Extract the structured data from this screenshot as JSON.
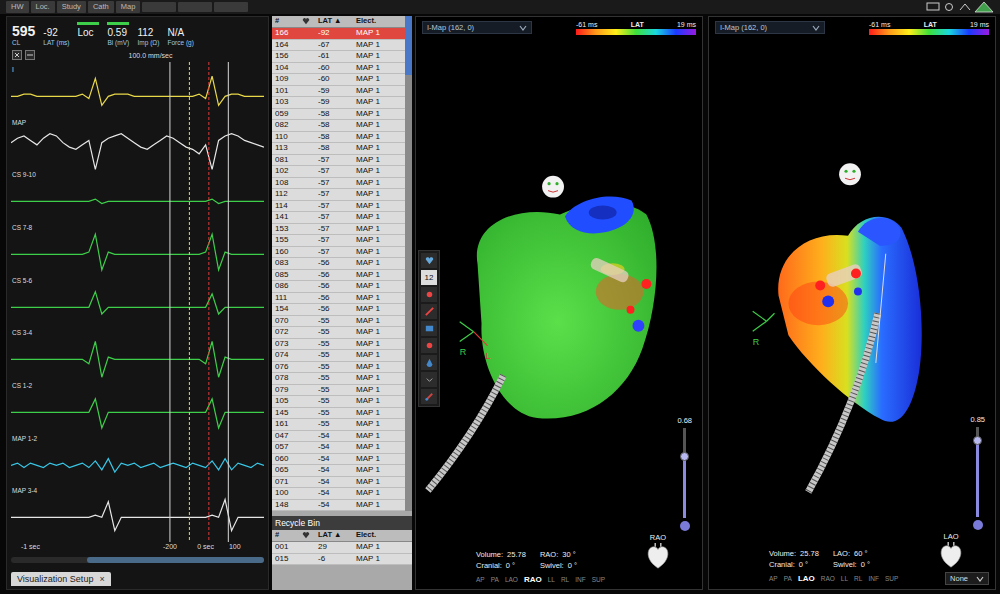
{
  "topbar": {
    "tabs": [
      {
        "label": "HW"
      },
      {
        "label": "Loc."
      },
      {
        "label": "Study"
      },
      {
        "label": "Cath"
      },
      {
        "label": "Map"
      }
    ]
  },
  "readouts": [
    {
      "value": "595",
      "label": "CL",
      "indicator": false,
      "large": true
    },
    {
      "value": "-92",
      "label": "LAT (ms)",
      "indicator": false,
      "large": false
    },
    {
      "value": "Loc",
      "label": "",
      "indicator": true,
      "large": false
    },
    {
      "value": "0.59",
      "label": "Bi (mV)",
      "indicator": true,
      "large": false
    },
    {
      "value": "112",
      "label": "Imp (Ω)",
      "indicator": false,
      "large": false
    },
    {
      "value": "N/A",
      "label": "Force (g)",
      "indicator": false,
      "large": false
    }
  ],
  "signals": {
    "speed": "100.0 mm/sec",
    "traces": [
      {
        "label": "I",
        "color": "#e8d84a",
        "values": [
          0,
          0,
          1,
          1,
          0,
          0,
          0,
          0,
          0,
          0,
          0,
          1,
          -1,
          8,
          -4,
          0,
          1,
          1,
          1,
          0,
          0,
          0,
          0,
          0,
          0,
          0,
          0,
          0,
          0,
          1,
          -1,
          9,
          -4,
          0,
          1,
          1,
          0,
          0,
          0,
          0
        ]
      },
      {
        "label": "MAP",
        "color": "#e6e6e6",
        "values": [
          3,
          5,
          6,
          4,
          2,
          5,
          7,
          6,
          3,
          1,
          0,
          2,
          4,
          -9,
          3,
          5,
          6,
          7,
          5,
          3,
          1,
          0,
          2,
          4,
          6,
          5,
          3,
          1,
          0,
          -2,
          2,
          -9,
          4,
          6,
          7,
          6,
          4,
          3,
          2,
          1
        ]
      },
      {
        "label": "CS 9-10",
        "color": "#3ecf4a",
        "values": [
          0,
          0,
          0,
          0,
          0,
          0,
          0,
          0,
          0,
          0,
          0,
          0,
          0,
          1,
          -1,
          0,
          0,
          0,
          0,
          0,
          0,
          0,
          0,
          0,
          0,
          0,
          0,
          0,
          0,
          0,
          0,
          1,
          -1,
          0,
          0,
          0,
          0,
          0,
          0,
          0
        ]
      },
      {
        "label": "CS 7-8",
        "color": "#3ecf4a",
        "values": [
          0,
          0,
          0,
          0,
          0,
          0,
          0,
          0,
          0,
          0,
          0,
          0,
          1,
          9,
          -7,
          1,
          0,
          0,
          0,
          0,
          0,
          0,
          0,
          0,
          0,
          0,
          0,
          0,
          0,
          0,
          1,
          9,
          -7,
          1,
          0,
          0,
          0,
          0,
          0,
          0
        ]
      },
      {
        "label": "CS 5-6",
        "color": "#3ecf4a",
        "values": [
          0,
          0,
          0,
          0,
          0,
          0,
          0,
          0,
          0,
          0,
          0,
          0,
          0,
          7,
          -3,
          0,
          0,
          0,
          0,
          0,
          0,
          0,
          0,
          0,
          0,
          0,
          0,
          0,
          0,
          0,
          0,
          6,
          -3,
          0,
          0,
          0,
          0,
          0,
          0,
          0
        ]
      },
      {
        "label": "CS 3-4",
        "color": "#3ecf4a",
        "values": [
          0,
          0,
          0,
          0,
          0,
          0,
          0,
          0,
          0,
          0,
          0,
          0,
          -2,
          8,
          -8,
          1,
          0,
          0,
          0,
          0,
          0,
          0,
          0,
          0,
          0,
          0,
          0,
          0,
          0,
          0,
          -2,
          8,
          -8,
          1,
          0,
          0,
          0,
          0,
          0,
          0
        ]
      },
      {
        "label": "CS 1-2",
        "color": "#3ecf4a",
        "values": [
          0,
          0,
          0,
          0,
          0,
          0,
          0,
          0,
          0,
          0,
          0,
          0,
          0,
          6,
          -7,
          0,
          0,
          0,
          0,
          0,
          0,
          0,
          0,
          0,
          0,
          0,
          0,
          0,
          0,
          0,
          0,
          6,
          -7,
          0,
          0,
          0,
          0,
          0,
          0,
          0
        ]
      },
      {
        "label": "MAP 1-2",
        "color": "#39c6e6",
        "values": [
          0,
          1,
          -1,
          1,
          0,
          -1,
          1,
          0,
          1,
          -1,
          0,
          1,
          -1,
          2,
          -2,
          3,
          -3,
          1,
          0,
          1,
          -1,
          0,
          1,
          -1,
          0,
          1,
          0,
          -1,
          1,
          0,
          -1,
          2,
          -2,
          3,
          -2,
          1,
          0,
          -1,
          1,
          0
        ]
      },
      {
        "label": "MAP 3-4",
        "color": "#e6e6e6",
        "values": [
          0,
          0,
          0,
          0,
          0,
          0,
          0,
          0,
          0,
          0,
          0,
          0,
          0,
          1,
          0,
          7,
          -6,
          0,
          0,
          0,
          0,
          0,
          0,
          0,
          0,
          0,
          0,
          0,
          0,
          0,
          0,
          1,
          0,
          8,
          -6,
          0,
          0,
          0,
          0,
          0
        ]
      }
    ],
    "markers": [
      {
        "t": 24.5,
        "color": "#d8d8d8",
        "dashed": false
      },
      {
        "t": 27.5,
        "color": "#e8d84a",
        "dashed": true
      },
      {
        "t": 30.5,
        "color": "#e03a3a",
        "dashed": true
      },
      {
        "t": 33.5,
        "color": "#d8d8d8",
        "dashed": false
      }
    ],
    "axis": [
      {
        "label": "-1 sec",
        "t": 3
      },
      {
        "label": "-200",
        "t": 24.5
      },
      {
        "label": "0 sec",
        "t": 30
      },
      {
        "label": "100",
        "t": 34.5
      }
    ]
  },
  "bottom_tab": {
    "label": "Visualization Setup",
    "close": "×"
  },
  "point_list": {
    "columns": [
      {
        "label": "#",
        "kind": "text"
      },
      {
        "label": "",
        "kind": "icon"
      },
      {
        "label": "LAT ▲",
        "kind": "text"
      },
      {
        "label": "Elect.",
        "kind": "text"
      }
    ],
    "rows": [
      {
        "id": "166",
        "lat": "-92",
        "electrode": "MAP 1",
        "selected": true
      },
      {
        "id": "164",
        "lat": "-67",
        "electrode": "MAP 1",
        "selected": false
      },
      {
        "id": "156",
        "lat": "-61",
        "electrode": "MAP 1",
        "selected": false
      },
      {
        "id": "104",
        "lat": "-60",
        "electrode": "MAP 1",
        "selected": false
      },
      {
        "id": "109",
        "lat": "-60",
        "electrode": "MAP 1",
        "selected": false
      },
      {
        "id": "101",
        "lat": "-59",
        "electrode": "MAP 1",
        "selected": false
      },
      {
        "id": "103",
        "lat": "-59",
        "electrode": "MAP 1",
        "selected": false
      },
      {
        "id": "059",
        "lat": "-58",
        "electrode": "MAP 1",
        "selected": false
      },
      {
        "id": "082",
        "lat": "-58",
        "electrode": "MAP 1",
        "selected": false
      },
      {
        "id": "110",
        "lat": "-58",
        "electrode": "MAP 1",
        "selected": false
      },
      {
        "id": "113",
        "lat": "-58",
        "electrode": "MAP 1",
        "selected": false
      },
      {
        "id": "081",
        "lat": "-57",
        "electrode": "MAP 1",
        "selected": false
      },
      {
        "id": "102",
        "lat": "-57",
        "electrode": "MAP 1",
        "selected": false
      },
      {
        "id": "108",
        "lat": "-57",
        "electrode": "MAP 1",
        "selected": false
      },
      {
        "id": "112",
        "lat": "-57",
        "electrode": "MAP 1",
        "selected": false
      },
      {
        "id": "114",
        "lat": "-57",
        "electrode": "MAP 1",
        "selected": false
      },
      {
        "id": "141",
        "lat": "-57",
        "electrode": "MAP 1",
        "selected": false
      },
      {
        "id": "153",
        "lat": "-57",
        "electrode": "MAP 1",
        "selected": false
      },
      {
        "id": "155",
        "lat": "-57",
        "electrode": "MAP 1",
        "selected": false
      },
      {
        "id": "160",
        "lat": "-57",
        "electrode": "MAP 1",
        "selected": false
      },
      {
        "id": "083",
        "lat": "-56",
        "electrode": "MAP 1",
        "selected": false
      },
      {
        "id": "085",
        "lat": "-56",
        "electrode": "MAP 1",
        "selected": false
      },
      {
        "id": "086",
        "lat": "-56",
        "electrode": "MAP 1",
        "selected": false
      },
      {
        "id": "111",
        "lat": "-56",
        "electrode": "MAP 1",
        "selected": false
      },
      {
        "id": "154",
        "lat": "-56",
        "electrode": "MAP 1",
        "selected": false
      },
      {
        "id": "070",
        "lat": "-55",
        "electrode": "MAP 1",
        "selected": false
      },
      {
        "id": "072",
        "lat": "-55",
        "electrode": "MAP 1",
        "selected": false
      },
      {
        "id": "073",
        "lat": "-55",
        "electrode": "MAP 1",
        "selected": false
      },
      {
        "id": "074",
        "lat": "-55",
        "electrode": "MAP 1",
        "selected": false
      },
      {
        "id": "076",
        "lat": "-55",
        "electrode": "MAP 1",
        "selected": false
      },
      {
        "id": "078",
        "lat": "-55",
        "electrode": "MAP 1",
        "selected": false
      },
      {
        "id": "079",
        "lat": "-55",
        "electrode": "MAP 1",
        "selected": false
      },
      {
        "id": "105",
        "lat": "-55",
        "electrode": "MAP 1",
        "selected": false
      },
      {
        "id": "145",
        "lat": "-55",
        "electrode": "MAP 1",
        "selected": false
      },
      {
        "id": "161",
        "lat": "-55",
        "electrode": "MAP 1",
        "selected": false
      },
      {
        "id": "047",
        "lat": "-54",
        "electrode": "MAP 1",
        "selected": false
      },
      {
        "id": "057",
        "lat": "-54",
        "electrode": "MAP 1",
        "selected": false
      },
      {
        "id": "060",
        "lat": "-54",
        "electrode": "MAP 1",
        "selected": false
      },
      {
        "id": "065",
        "lat": "-54",
        "electrode": "MAP 1",
        "selected": false
      },
      {
        "id": "071",
        "lat": "-54",
        "electrode": "MAP 1",
        "selected": false
      },
      {
        "id": "100",
        "lat": "-54",
        "electrode": "MAP 1",
        "selected": false
      },
      {
        "id": "148",
        "lat": "-54",
        "electrode": "MAP 1",
        "selected": false
      }
    ]
  },
  "recycle_bin": {
    "title": "Recycle Bin",
    "columns": [
      {
        "label": "#",
        "kind": "text"
      },
      {
        "label": "",
        "kind": "icon"
      },
      {
        "label": "LAT ▲",
        "kind": "text"
      },
      {
        "label": "Elect.",
        "kind": "text"
      }
    ],
    "rows": [
      {
        "id": "001",
        "lat": "29",
        "electrode": "MAP 1",
        "selected": false
      },
      {
        "id": "015",
        "lat": "-6",
        "electrode": "MAP 1",
        "selected": false
      }
    ]
  },
  "tool_strip": {
    "count": "12"
  },
  "maps": [
    {
      "kind": "rao",
      "title": "I-Map (162, 0)",
      "scale": {
        "min": "-61 ms",
        "label": "LAT",
        "max": "19 ms"
      },
      "opacity": {
        "reading": "0.68",
        "level": 0.68
      },
      "heart_label": "RAO",
      "info": [
        {
          "label": "Volume:",
          "value": "25.78"
        },
        {
          "label": "RAO:",
          "value": "30 °"
        },
        {
          "label": "Cranial:",
          "value": "0 °"
        },
        {
          "label": "Swivel:",
          "value": "0 °"
        }
      ],
      "views": [
        {
          "label": "AP",
          "selected": false
        },
        {
          "label": "PA",
          "selected": false
        },
        {
          "label": "LAO",
          "selected": false
        },
        {
          "label": "RAO",
          "selected": true
        },
        {
          "label": "LL",
          "selected": false
        },
        {
          "label": "RL",
          "selected": false
        },
        {
          "label": "INF",
          "selected": false
        },
        {
          "label": "SUP",
          "selected": false
        }
      ],
      "axis_labels": [
        {
          "label": "R",
          "color": "#3ecf4a"
        },
        {
          "label": "L",
          "color": "#e03a3a"
        }
      ],
      "dropdown": null
    },
    {
      "kind": "lao",
      "title": "I-Map (162, 0)",
      "scale": {
        "min": "-61 ms",
        "label": "LAT",
        "max": "19 ms"
      },
      "opacity": {
        "reading": "0.85",
        "level": 0.85
      },
      "heart_label": "LAO",
      "info": [
        {
          "label": "Volume:",
          "value": "25.78"
        },
        {
          "label": "LAO:",
          "value": "60 °"
        },
        {
          "label": "Cranial:",
          "value": "0 °"
        },
        {
          "label": "Swivel:",
          "value": "0 °"
        }
      ],
      "views": [
        {
          "label": "AP",
          "selected": false
        },
        {
          "label": "PA",
          "selected": false
        },
        {
          "label": "LAO",
          "selected": true
        },
        {
          "label": "RAO",
          "selected": false
        },
        {
          "label": "LL",
          "selected": false
        },
        {
          "label": "RL",
          "selected": false
        },
        {
          "label": "INF",
          "selected": false
        },
        {
          "label": "SUP",
          "selected": false
        }
      ],
      "axis_labels": [
        {
          "label": "R",
          "color": "#3ecf4a"
        }
      ],
      "dropdown": "None"
    }
  ]
}
